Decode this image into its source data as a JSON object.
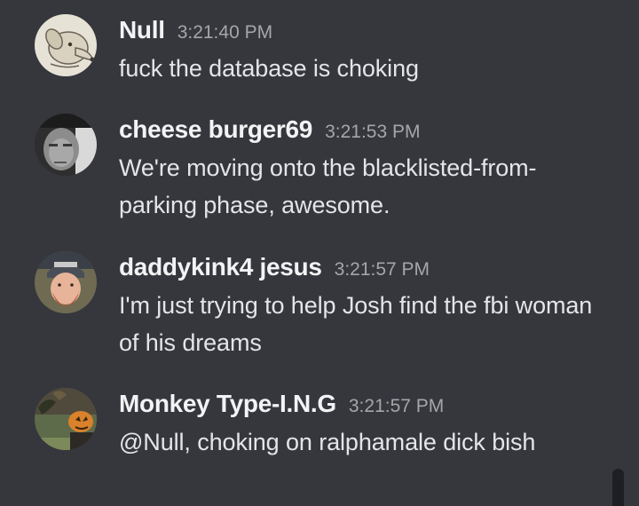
{
  "messages": [
    {
      "username": "Null",
      "timestamp": "3:21:40 PM",
      "text": "fuck the database is choking"
    },
    {
      "username": "cheese burger69",
      "timestamp": "3:21:53 PM",
      "text": "We're moving onto the blacklisted-from-parking phase, awesome."
    },
    {
      "username": "daddykink4 jesus",
      "timestamp": "3:21:57 PM",
      "text": "I'm just trying to help Josh find the fbi woman of his dreams"
    },
    {
      "username": "Monkey Type-I.N.G",
      "timestamp": "3:21:57 PM",
      "text": "@Null, choking on ralphamale dick bish"
    }
  ],
  "colors": {
    "background": "#36373d",
    "username": "#f2f3f5",
    "timestamp": "#a3a6aa",
    "message_text": "#e3e5e8"
  }
}
